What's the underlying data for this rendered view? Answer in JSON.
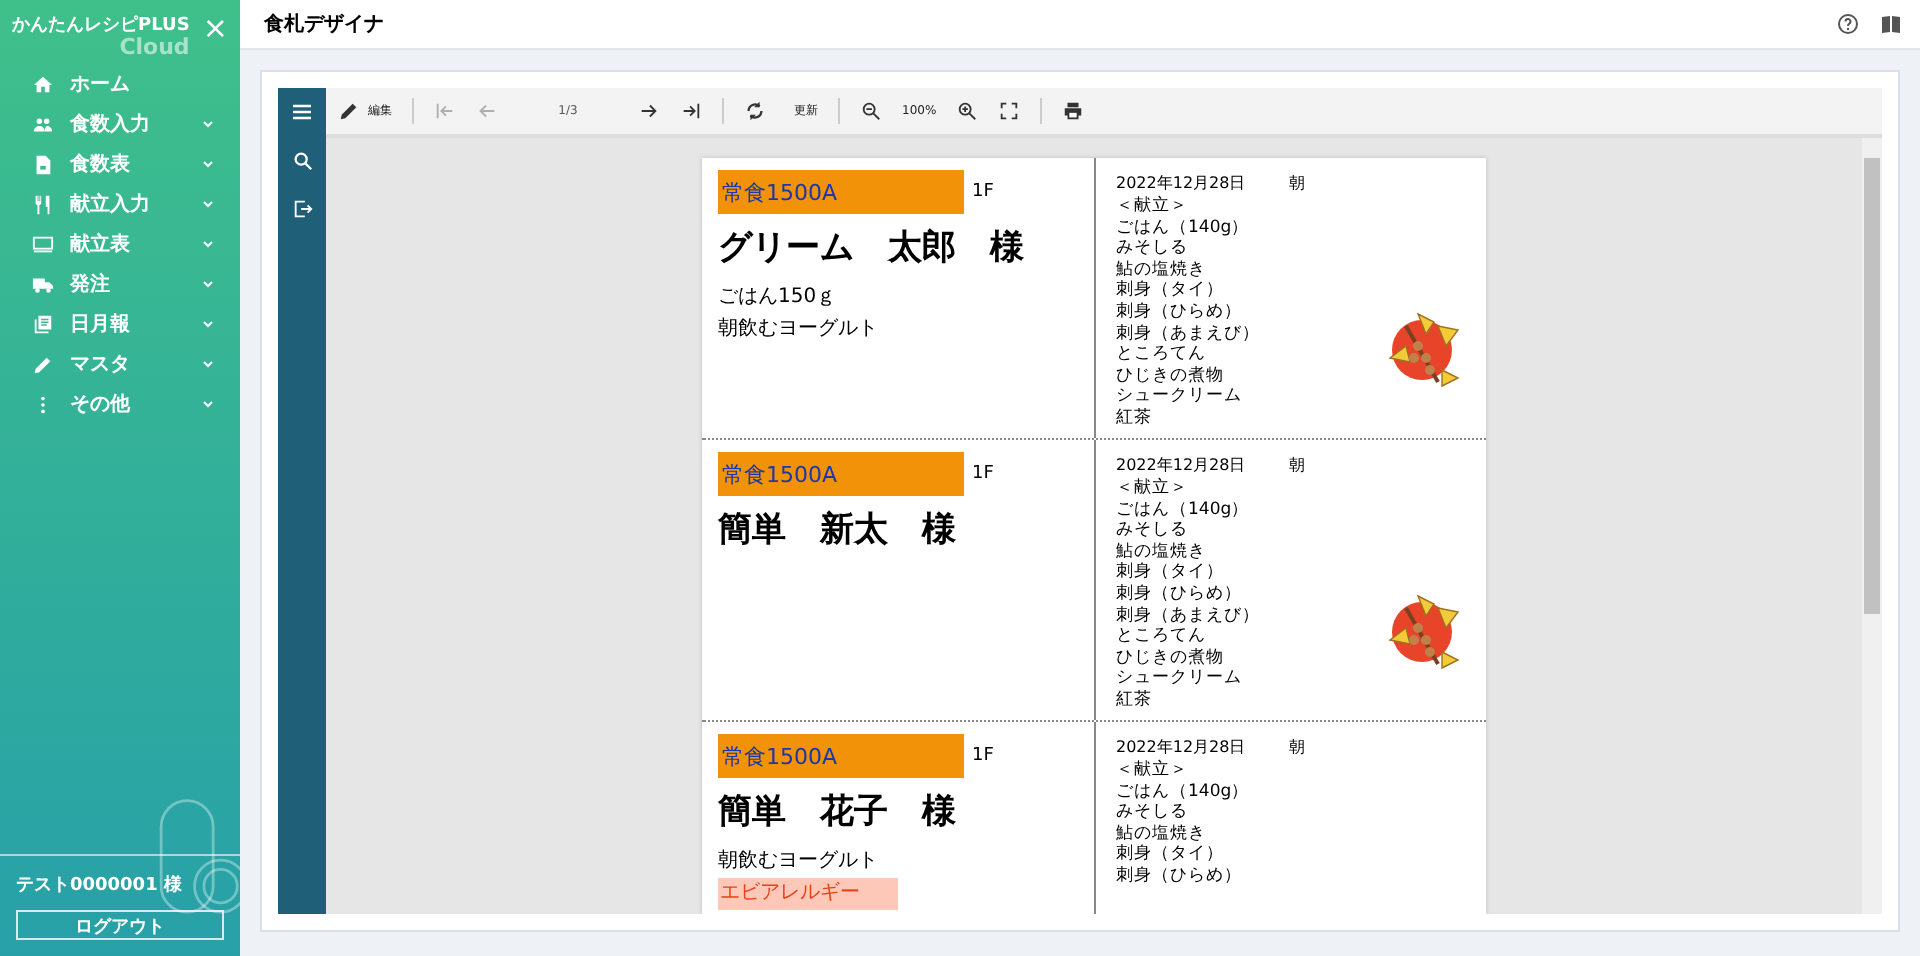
{
  "sidebar": {
    "brand": "かんたんレシピPLUS",
    "brand_sub": "Cloud",
    "close": "×",
    "items": [
      {
        "kind": "home",
        "label": "ホーム",
        "expandable": false
      },
      {
        "kind": "people",
        "label": "食数入力",
        "expandable": true
      },
      {
        "kind": "doc",
        "label": "食数表",
        "expandable": true
      },
      {
        "kind": "cutlery",
        "label": "献立入力",
        "expandable": true
      },
      {
        "kind": "monitor",
        "label": "献立表",
        "expandable": true
      },
      {
        "kind": "truck",
        "label": "発注",
        "expandable": true
      },
      {
        "kind": "book",
        "label": "日月報",
        "expandable": true
      },
      {
        "kind": "pencil",
        "label": "マスタ",
        "expandable": true
      },
      {
        "kind": "dots",
        "label": "その他",
        "expandable": true
      }
    ],
    "user": "テスト0000001 様",
    "logout": "ログアウト"
  },
  "header": {
    "title": "食札デザイナ"
  },
  "toolbar": [
    {
      "kind": "edit",
      "label": "編集",
      "disabled": false
    },
    {
      "kind": "first",
      "disabled": true
    },
    {
      "kind": "prev",
      "disabled": true
    },
    {
      "kind": "page",
      "label": "1/3",
      "disabled": false
    },
    {
      "kind": "next",
      "disabled": false
    },
    {
      "kind": "last",
      "disabled": false
    },
    {
      "kind": "refresh",
      "label": "更新",
      "disabled": false
    },
    {
      "kind": "zoom-out",
      "disabled": false
    },
    {
      "kind": "zoom",
      "label": "100%",
      "disabled": false
    },
    {
      "kind": "zoom-in",
      "disabled": false
    },
    {
      "kind": "fit",
      "disabled": false
    },
    {
      "kind": "print",
      "disabled": false
    }
  ],
  "cards": [
    {
      "diet": "常食1500A",
      "floor": "1F",
      "name": "グリーム　太郎　様",
      "notes": [
        {
          "kind": "normal",
          "text": "ごはん150ｇ"
        },
        {
          "kind": "normal",
          "text": "朝飲むヨーグルト"
        }
      ],
      "date": "2022年12月28日",
      "meal": "朝",
      "menu": [
        "＜献立＞",
        "ごはん（140g）",
        "みそしる",
        "鮎の塩焼き",
        "刺身（タイ）",
        "刺身（ひらめ）",
        "刺身（あまえび）",
        "ところてん",
        "ひじきの煮物",
        "シュークリーム",
        "紅茶"
      ],
      "illustration": true
    },
    {
      "diet": "常食1500A",
      "floor": "1F",
      "name": "簡単　新太　様",
      "date": "2022年12月28日",
      "meal": "朝",
      "menu": [
        "＜献立＞",
        "ごはん（140g）",
        "みそしる",
        "鮎の塩焼き",
        "刺身（タイ）",
        "刺身（ひらめ）",
        "刺身（あまえび）",
        "ところてん",
        "ひじきの煮物",
        "シュークリーム",
        "紅茶"
      ],
      "illustration": true
    },
    {
      "diet": "常食1500A",
      "floor": "1F",
      "name": "簡単　花子　様",
      "notes": [
        {
          "kind": "normal",
          "text": "朝飲むヨーグルト"
        },
        {
          "kind": "allergy",
          "text": "エビアレルギー"
        }
      ],
      "date": "2022年12月28日",
      "meal": "朝",
      "menu": [
        "＜献立＞",
        "ごはん（140g）",
        "みそしる",
        "鮎の塩焼き",
        "刺身（タイ）",
        "刺身（ひらめ）"
      ],
      "illustration": false
    }
  ]
}
